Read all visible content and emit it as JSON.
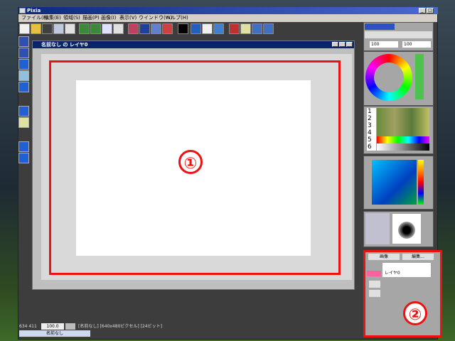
{
  "app": {
    "title": "Pixia"
  },
  "menu": [
    "ファイル(F)",
    "編集(E)",
    "領域(S)",
    "描画(P)",
    "画像(I)",
    "表示(V)",
    "ウインドウ(W)",
    "ヘルプ(H)"
  ],
  "canvas": {
    "title": "名前なし の レイヤ0"
  },
  "callouts": {
    "one": "①",
    "two": "②"
  },
  "palette_rows": [
    "1",
    "2",
    "3",
    "4",
    "5",
    "6"
  ],
  "brush": {
    "size": "100",
    "opacity": "100"
  },
  "layer_panel": {
    "tab1": "画像",
    "tab2": "編集...",
    "layer_name": "レイヤ0"
  },
  "status": {
    "coords": "634 411",
    "zoom": "100.0",
    "info": "[名前なし] [640x480ピクセル] [24ビット]",
    "tab": "名前なし"
  },
  "colors": {
    "accent": "#e11111",
    "titlebar": "#0a246a"
  }
}
